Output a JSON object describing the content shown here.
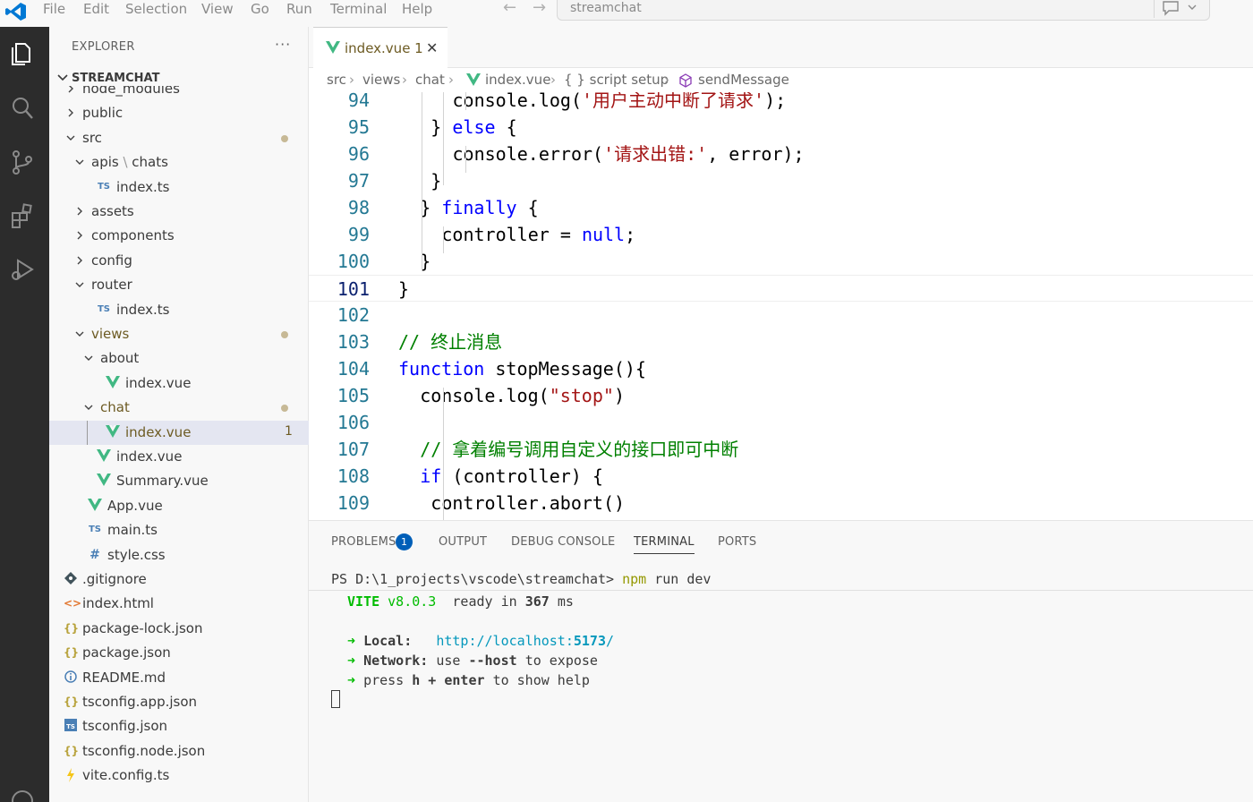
{
  "titlebar": {
    "menu": [
      "File",
      "Edit",
      "Selection",
      "View",
      "Go",
      "Run",
      "Terminal",
      "Help"
    ],
    "search_text": "streamchat"
  },
  "sidebar": {
    "title": "EXPLORER",
    "more": "···",
    "root": "STREAMCHAT",
    "items": [
      {
        "label": "node_modules",
        "type": "folder",
        "state": "collapsed",
        "depth": 0
      },
      {
        "label": "public",
        "type": "folder",
        "state": "collapsed",
        "depth": 0
      },
      {
        "label": "src",
        "type": "folder",
        "state": "expanded",
        "depth": 0,
        "dot": true
      },
      {
        "label": "apis",
        "label2": "chats",
        "type": "folder",
        "state": "expanded",
        "depth": 1
      },
      {
        "label": "index.ts",
        "type": "ts",
        "depth": 2
      },
      {
        "label": "assets",
        "type": "folder",
        "state": "collapsed",
        "depth": 1
      },
      {
        "label": "components",
        "type": "folder",
        "state": "collapsed",
        "depth": 1
      },
      {
        "label": "config",
        "type": "folder",
        "state": "collapsed",
        "depth": 1
      },
      {
        "label": "router",
        "type": "folder",
        "state": "expanded",
        "depth": 1
      },
      {
        "label": "index.ts",
        "type": "ts",
        "depth": 2
      },
      {
        "label": "views",
        "type": "folder",
        "state": "expanded",
        "depth": 1,
        "dot": true,
        "modified": true
      },
      {
        "label": "about",
        "type": "folder",
        "state": "expanded",
        "depth": 2
      },
      {
        "label": "index.vue",
        "type": "vue",
        "depth": 3
      },
      {
        "label": "chat",
        "type": "folder",
        "state": "expanded",
        "depth": 2,
        "dot": true,
        "modified": true
      },
      {
        "label": "index.vue",
        "type": "vue",
        "depth": 3,
        "selected": true,
        "badge": "1",
        "modified": true
      },
      {
        "label": "index.vue",
        "type": "vue",
        "depth": 2
      },
      {
        "label": "Summary.vue",
        "type": "vue",
        "depth": 2
      },
      {
        "label": "App.vue",
        "type": "vue",
        "depth": 1
      },
      {
        "label": "main.ts",
        "type": "ts",
        "depth": 1
      },
      {
        "label": "style.css",
        "type": "css",
        "depth": 1
      },
      {
        "label": ".gitignore",
        "type": "git",
        "depth": 0
      },
      {
        "label": "index.html",
        "type": "html",
        "depth": 0
      },
      {
        "label": "package-lock.json",
        "type": "json",
        "depth": 0
      },
      {
        "label": "package.json",
        "type": "json",
        "depth": 0
      },
      {
        "label": "README.md",
        "type": "info",
        "depth": 0
      },
      {
        "label": "tsconfig.app.json",
        "type": "json",
        "depth": 0
      },
      {
        "label": "tsconfig.json",
        "type": "tsconfig",
        "depth": 0
      },
      {
        "label": "tsconfig.node.json",
        "type": "json",
        "depth": 0
      },
      {
        "label": "vite.config.ts",
        "type": "vite",
        "depth": 0
      }
    ]
  },
  "tab": {
    "label": "index.vue 1",
    "close": "✕"
  },
  "breadcrumb": [
    "src",
    "views",
    "chat",
    "index.vue",
    "{ } script setup",
    "sendMessage"
  ],
  "editor": {
    "current_line": "101",
    "lines": [
      {
        "n": "94",
        "code": "console.log('用户主动中断了请求');"
      },
      {
        "n": "95",
        "code": "} else {"
      },
      {
        "n": "96",
        "code": "console.error('请求出错:', error);"
      },
      {
        "n": "97",
        "code": "}"
      },
      {
        "n": "98",
        "code": "} finally {"
      },
      {
        "n": "99",
        "code": "controller = null;"
      },
      {
        "n": "100",
        "code": "}"
      },
      {
        "n": "101",
        "code": "}"
      },
      {
        "n": "102",
        "code": ""
      },
      {
        "n": "103",
        "code": "// 终止消息"
      },
      {
        "n": "104",
        "code": "function stopMessage(){"
      },
      {
        "n": "105",
        "code": "console.log(\"stop\")"
      },
      {
        "n": "106",
        "code": ""
      },
      {
        "n": "107",
        "code": "// 拿着编号调用自定义的接口即可中断"
      },
      {
        "n": "108",
        "code": "if (controller) {"
      },
      {
        "n": "109",
        "code": "controller.abort()"
      }
    ]
  },
  "panel": {
    "tabs": [
      "PROBLEMS",
      "OUTPUT",
      "DEBUG CONSOLE",
      "TERMINAL",
      "PORTS"
    ],
    "active_tab": "TERMINAL",
    "problems_count": "1",
    "terminal": {
      "prompt": "PS D:\\1_projects\\vscode\\streamchat>",
      "command": "npm run dev",
      "vite_label": "VITE",
      "vite_version": "v8.0.3",
      "ready_text": "ready in",
      "ready_ms": "367",
      "ready_unit": "ms",
      "arrow": "➜",
      "local_label": "Local:",
      "local_url_prefix": "http://localhost:",
      "local_port": "5173",
      "local_url_suffix": "/",
      "network_label": "Network:",
      "network_text_1": "use",
      "network_flag": "--host",
      "network_text_2": "to expose",
      "help_text_1": "press",
      "help_key": "h + enter",
      "help_text_2": "to show help"
    }
  },
  "colors": {
    "activitybar": "#2c2c2c",
    "sidebar": "#f8f8f8",
    "selection": "#e4e6f1",
    "vue_green": "#41b883",
    "ts_blue": "#4a7fb5",
    "modified": "#6d5b23",
    "keyword": "#0000ff",
    "string": "#a31515",
    "comment": "#008000",
    "line_number": "#237893",
    "badge": "#005fb8"
  }
}
